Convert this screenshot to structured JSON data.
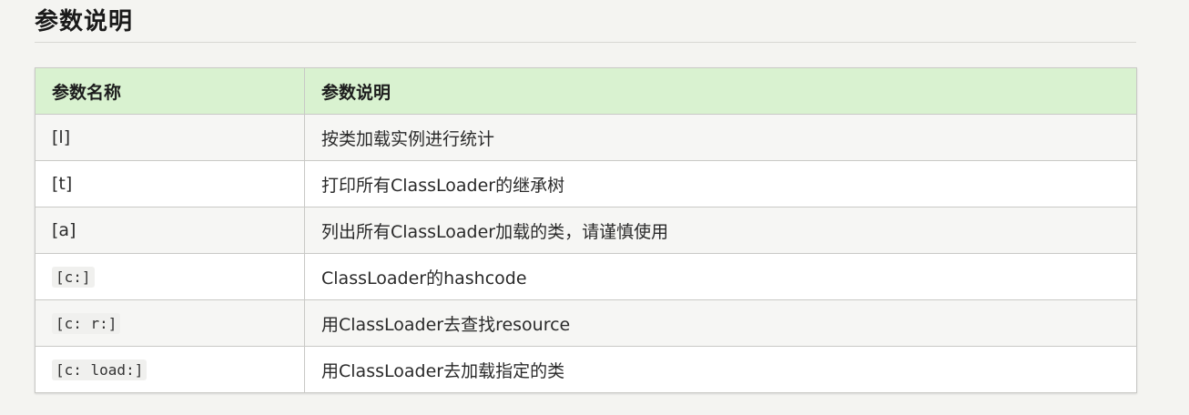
{
  "section": {
    "title": "参数说明"
  },
  "table": {
    "headers": [
      "参数名称",
      "参数说明"
    ],
    "rows": [
      {
        "param": "[l]",
        "code": false,
        "desc": "按类加载实例进行统计"
      },
      {
        "param": "[t]",
        "code": false,
        "desc": "打印所有ClassLoader的继承树"
      },
      {
        "param": "[a]",
        "code": false,
        "desc": "列出所有ClassLoader加载的类，请谨慎使用"
      },
      {
        "param": "[c:]",
        "code": true,
        "desc": "ClassLoader的hashcode"
      },
      {
        "param": "[c: r:]",
        "code": true,
        "desc": "用ClassLoader去查找resource"
      },
      {
        "param": "[c: load:]",
        "code": true,
        "desc": "用ClassLoader去加载指定的类"
      }
    ]
  }
}
